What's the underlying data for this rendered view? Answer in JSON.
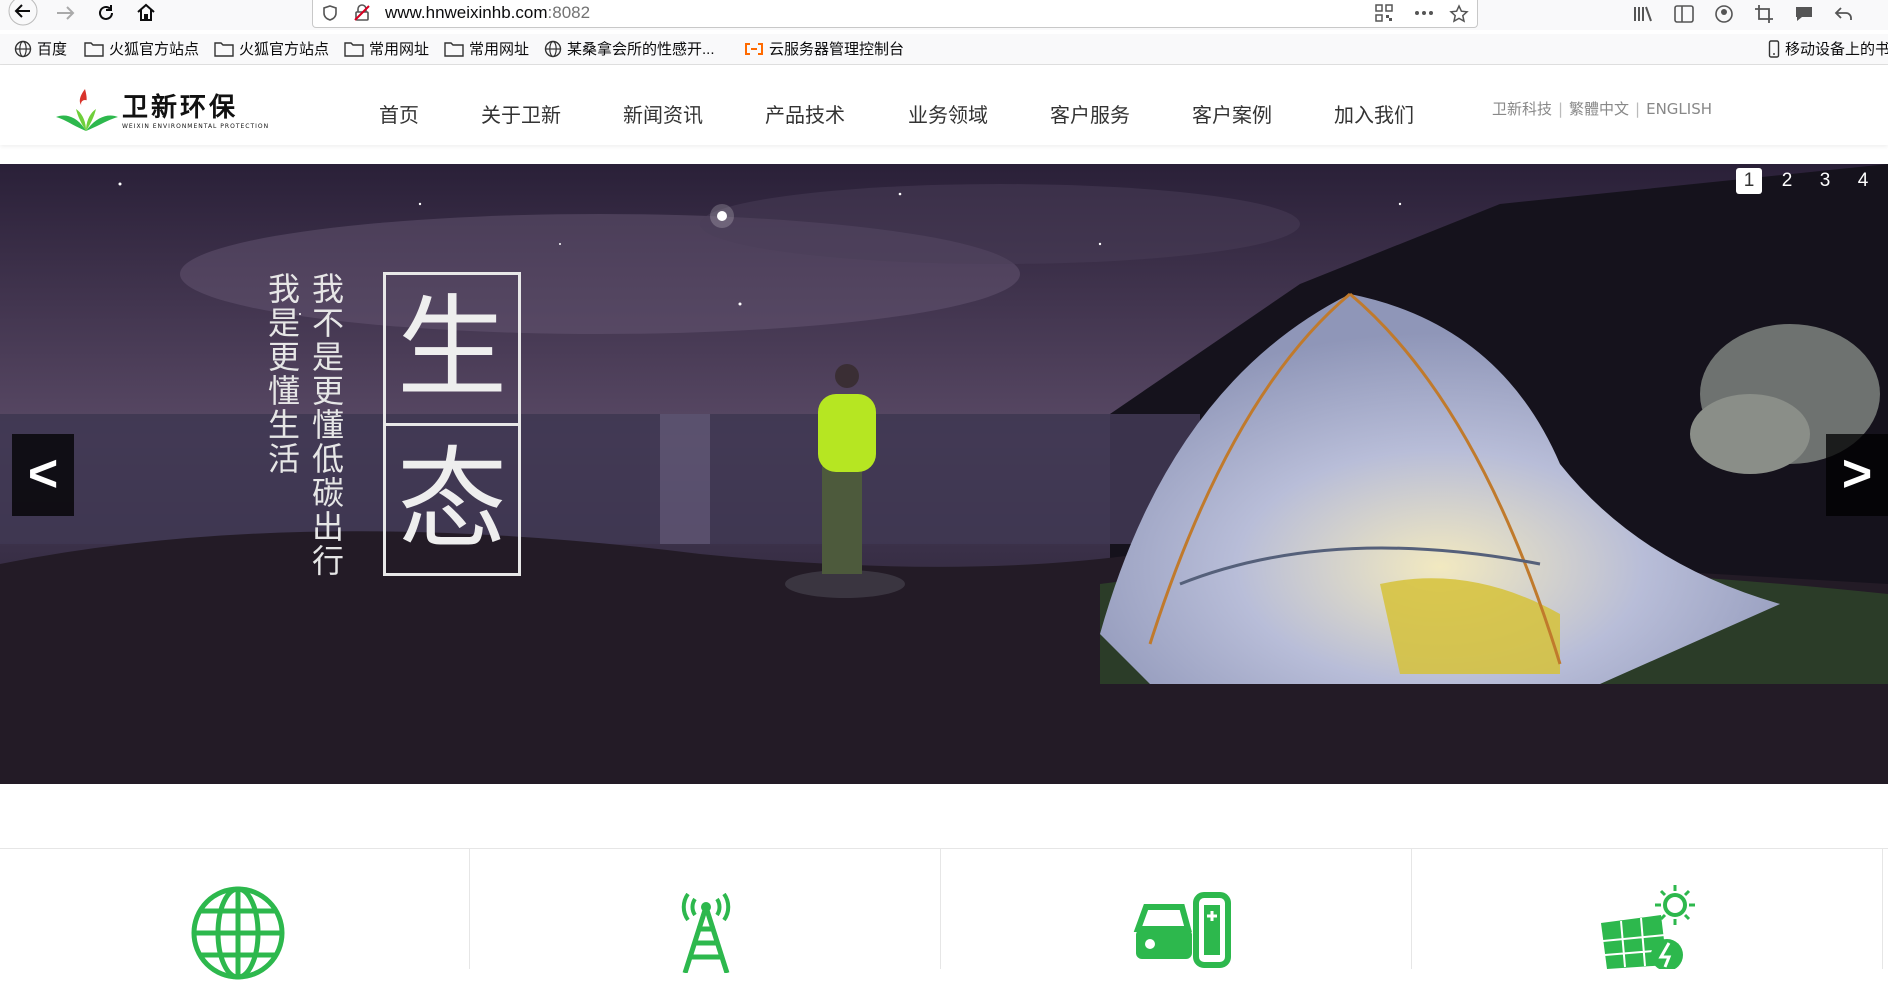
{
  "browser": {
    "url_host": "www.hnweixinhb.com",
    "url_port": ":8082",
    "bookmarks": [
      {
        "label": "百度",
        "icon": "globe-icon"
      },
      {
        "label": "火狐官方站点",
        "icon": "folder-icon"
      },
      {
        "label": "火狐官方站点",
        "icon": "folder-icon"
      },
      {
        "label": "常用网址",
        "icon": "folder-icon"
      },
      {
        "label": "常用网址",
        "icon": "folder-icon"
      },
      {
        "label": "某桑拿会所的性感开...",
        "icon": "globe-icon"
      },
      {
        "label": "云服务器管理控制台",
        "icon": "aliyun-icon"
      }
    ],
    "mobile_bookmarks": "移动设备上的书"
  },
  "site": {
    "logo_cn": "卫新环保",
    "logo_en": "WEIXIN ENVIRONMENTAL PROTECTION",
    "nav": [
      "首页",
      "关于卫新",
      "新闻资讯",
      "产品技术",
      "业务领域",
      "客户服务",
      "客户案例",
      "加入我们"
    ],
    "lang": {
      "a": "卫新科技",
      "b": "繁體中文",
      "c": "ENGLISH",
      "sep": "|"
    },
    "brand_color": "#2db84d"
  },
  "banner": {
    "pager": [
      "1",
      "2",
      "3",
      "4"
    ],
    "active_page": "1",
    "prev": "<",
    "next": ">",
    "line1": "我不是更懂低碳出行",
    "line2": "我是更懂生活",
    "eco1": "生",
    "eco2": "态"
  },
  "services": {
    "icons": [
      "globe-icon",
      "radio-tower-icon",
      "charging-station-icon",
      "solar-panel-icon"
    ]
  }
}
